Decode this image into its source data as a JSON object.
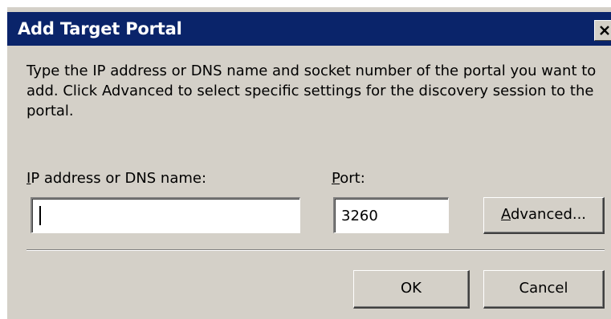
{
  "window": {
    "title": "Add Target Portal",
    "close_icon": "close-x-icon"
  },
  "instructions": "Type the IP address or DNS name and socket number of the portal you want to add. Click Advanced to select specific settings for the discovery session to the portal.",
  "ip_field": {
    "label_mnemonic": "I",
    "label_rest": "P address or DNS name:",
    "value": ""
  },
  "port_field": {
    "label_mnemonic": "P",
    "label_rest": "ort:",
    "value": "3260"
  },
  "buttons": {
    "advanced_mnemonic": "A",
    "advanced_rest": "dvanced...",
    "ok": "OK",
    "cancel": "Cancel"
  },
  "colors": {
    "titlebar": "#0a246a",
    "dialog_face": "#d4d0c8"
  }
}
